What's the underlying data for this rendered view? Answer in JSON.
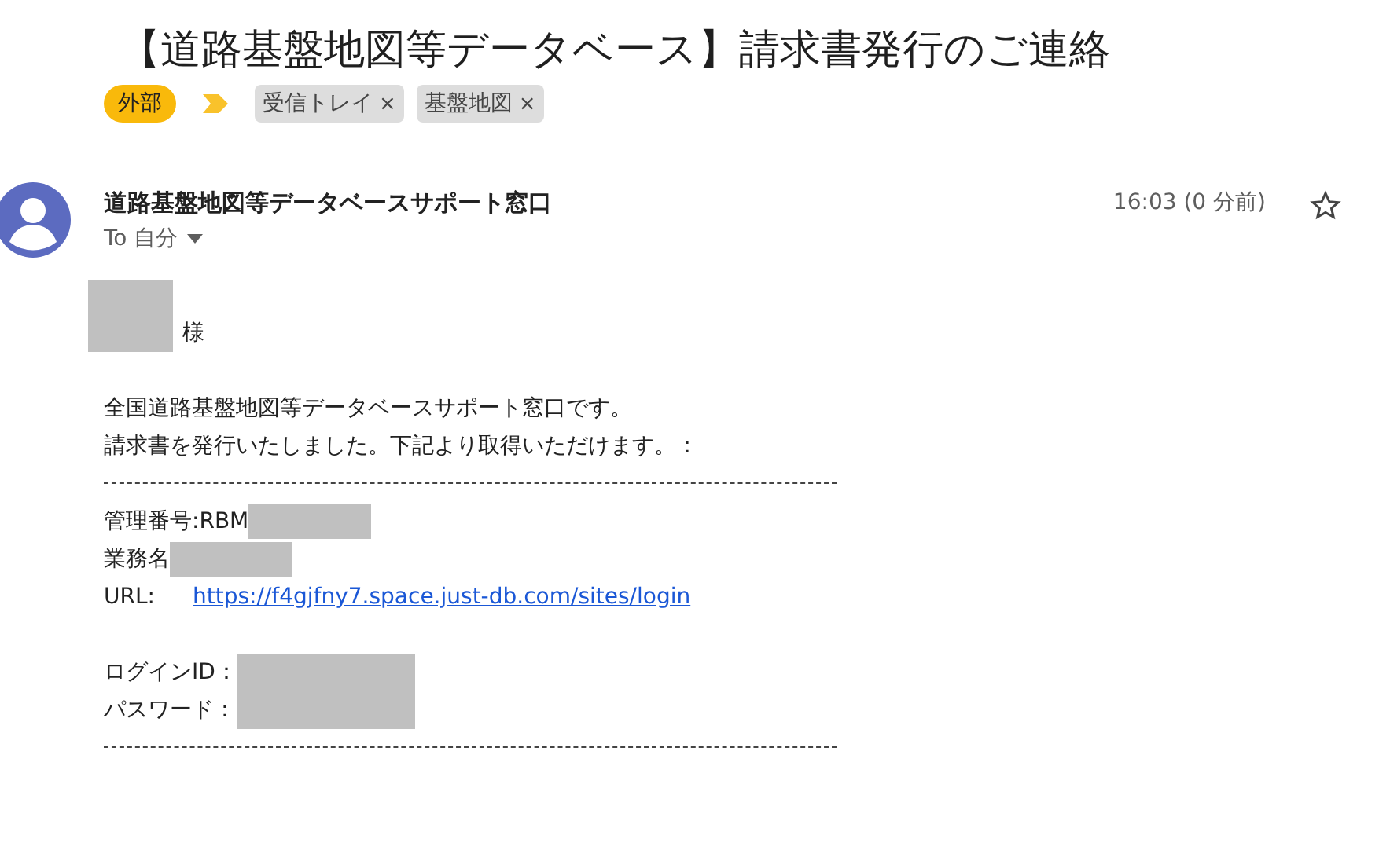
{
  "subject": "【道路基盤地図等データベース】請求書発行のご連絡",
  "important": true,
  "labels": [
    {
      "kind": "external",
      "text": "外部"
    },
    {
      "kind": "chip",
      "text": "受信トレイ",
      "remove": "×"
    },
    {
      "kind": "chip",
      "text": "基盤地図",
      "remove": "×"
    }
  ],
  "sender": {
    "name": "道路基盤地図等データベースサポート窓口",
    "to": "To 自分",
    "time": "16:03 (0 分前)",
    "starred": false
  },
  "body": [
    {
      "kind": "salutation",
      "text": "様",
      "redacted": true
    },
    {
      "kind": "blank"
    },
    {
      "kind": "text",
      "text": "全国道路基盤地図等データベースサポート窓口です。"
    },
    {
      "kind": "text",
      "text": "請求書を発行いたしました。下記より取得いただけます。："
    },
    {
      "kind": "divider"
    },
    {
      "kind": "field",
      "label": "管理番号:RBM",
      "redacted": true
    },
    {
      "kind": "field",
      "label": "業務名",
      "redacted": true
    },
    {
      "kind": "link",
      "label": "URL:",
      "url": "https://f4gjfny7.space.just-db.com/sites/login"
    },
    {
      "kind": "blank"
    },
    {
      "kind": "field",
      "label": "ログインID：",
      "redacted": true,
      "tall": true
    },
    {
      "kind": "field",
      "label": "パスワード：",
      "redacted": false
    },
    {
      "kind": "divider"
    }
  ]
}
